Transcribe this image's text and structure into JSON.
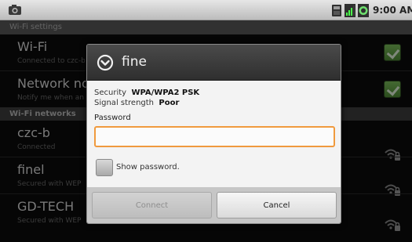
{
  "status_bar": {
    "time": "9:00 AM",
    "icons": [
      "camera-icon",
      "storage-icon",
      "signal-icon",
      "battery-icon"
    ]
  },
  "screen": {
    "title": "Wi-Fi settings"
  },
  "settings": {
    "wifi": {
      "title": "Wi-Fi",
      "summary": "Connected to czc-b",
      "checked": true
    },
    "network_notification": {
      "title": "Network notification",
      "summary": "Notify me when an open network is available",
      "checked": true
    },
    "section_header": "Wi-Fi networks",
    "networks": [
      {
        "name": "czc-b",
        "status": "Connected"
      },
      {
        "name": "finel",
        "status": "Secured with WEP"
      },
      {
        "name": "GD-TECH",
        "status": "Secured with WEP"
      }
    ]
  },
  "dialog": {
    "title": "fine",
    "security_label": "Security",
    "security_value": "WPA/WPA2 PSK",
    "signal_label": "Signal strength",
    "signal_value": "Poor",
    "password_label": "Password",
    "password_value": "",
    "show_password_label": "Show password.",
    "show_password_checked": false,
    "connect_label": "Connect",
    "connect_enabled": false,
    "cancel_label": "Cancel"
  },
  "colors": {
    "focus_orange": "#f09a3e",
    "check_green": "#5fa03f",
    "dialog_header": "#3a3a3a",
    "dialog_body": "#f3f3f3"
  }
}
